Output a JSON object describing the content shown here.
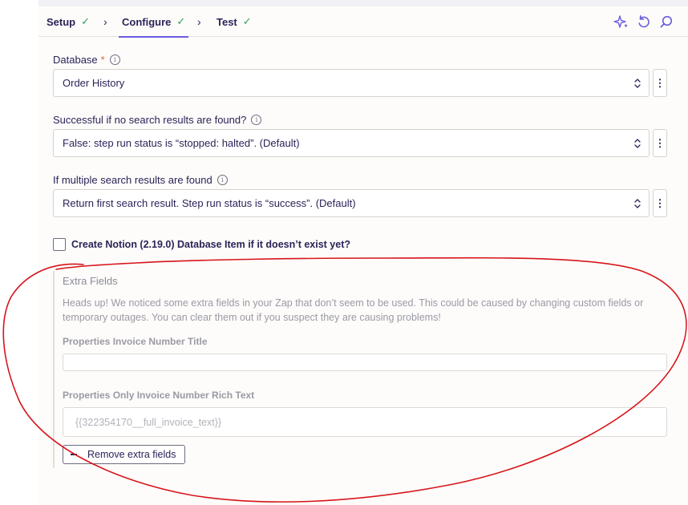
{
  "tabs": [
    {
      "label": "Setup",
      "status": "✓"
    },
    {
      "label": "Configure",
      "status": "✓"
    },
    {
      "label": "Test",
      "status": "✓"
    }
  ],
  "tab_separator": "›",
  "toolbar_icons": [
    "sparkle-icon",
    "undo-icon",
    "search-icon"
  ],
  "accent_color": "#6a5ce0",
  "check_color": "#2f9e5b",
  "annotation_color": "#d7141a",
  "form": {
    "database": {
      "label": "Database",
      "required_mark": "*",
      "value": "Order History"
    },
    "no_results": {
      "label": "Successful if no search results are found?",
      "value": "False: step run status is “stopped: halted”. (Default)"
    },
    "multiple_results": {
      "label": "If multiple search results are found",
      "value": "Return first search result. Step run status is “success”. (Default)"
    },
    "create_item": {
      "label": "Create Notion (2.19.0) Database Item if it doesn’t exist yet?",
      "checked": false
    }
  },
  "extra_fields": {
    "title": "Extra Fields",
    "description": "Heads up! We noticed some extra fields in your Zap that don’t seem to be used. This could be caused by changing custom fields or temporary outages. You can clear them out if you suspect they are causing problems!",
    "fields": [
      {
        "label": "Properties Invoice Number Title",
        "value": ""
      },
      {
        "label": "Properties Only Invoice Number Rich Text",
        "value": "{{322354170__full_invoice_text}}"
      }
    ],
    "remove_button": "Remove extra fields"
  }
}
